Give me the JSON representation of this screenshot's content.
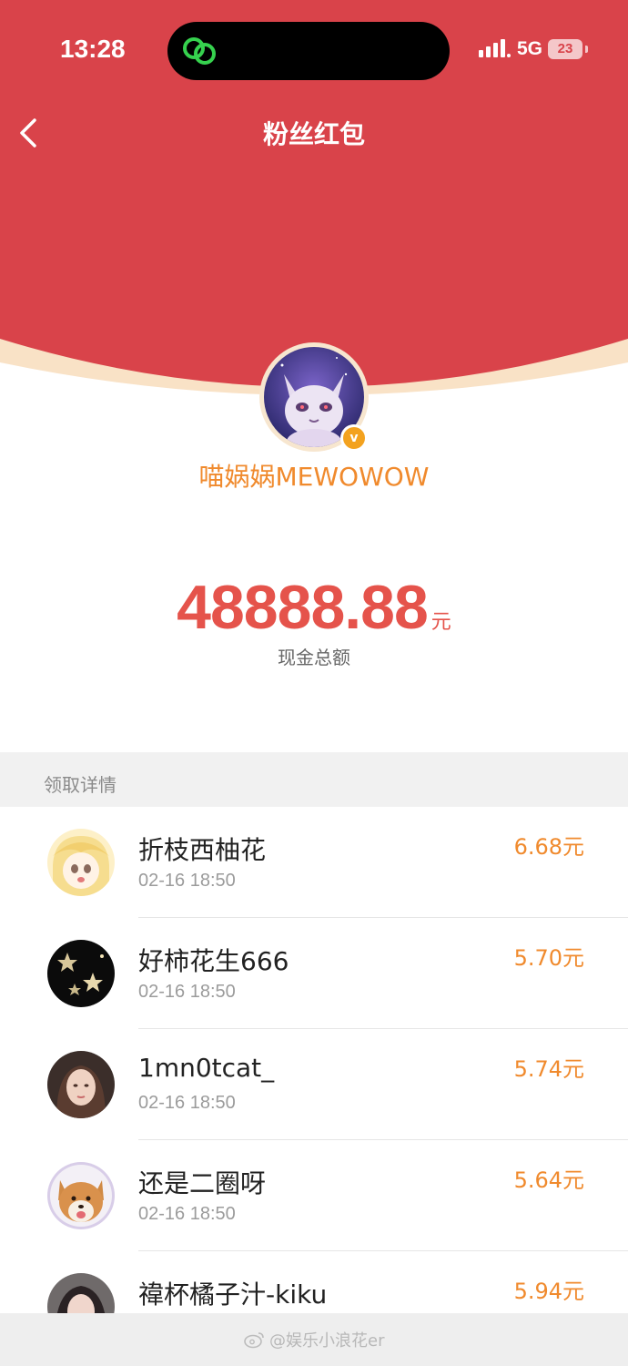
{
  "status_bar": {
    "time": "13:28",
    "network": "5G",
    "battery": "23"
  },
  "nav": {
    "title": "粉丝红包"
  },
  "creator": {
    "name": "喵娲娲MEWOWOW"
  },
  "summary": {
    "amount": "48888.88",
    "unit": "元",
    "label": "现金总额"
  },
  "section": {
    "title": "领取详情"
  },
  "records": [
    {
      "name": "折枝西柚花",
      "time": "02-16 18:50",
      "amount": "6.68元"
    },
    {
      "name": "好柿花生666",
      "time": "02-16 18:50",
      "amount": "5.70元"
    },
    {
      "name": "1mn0tcat_",
      "time": "02-16 18:50",
      "amount": "5.74元"
    },
    {
      "name": "还是二圈呀",
      "time": "02-16 18:50",
      "amount": "5.64元"
    },
    {
      "name": "禕杯橘子汁-kiku",
      "time": "",
      "amount": "5.94元"
    }
  ],
  "watermark": "@娱乐小浪花er",
  "colors": {
    "header_red": "#d9434a",
    "header_edge": "#f9e2c6",
    "amount_red": "#e5534b",
    "accent_orange": "#f08a2d"
  }
}
